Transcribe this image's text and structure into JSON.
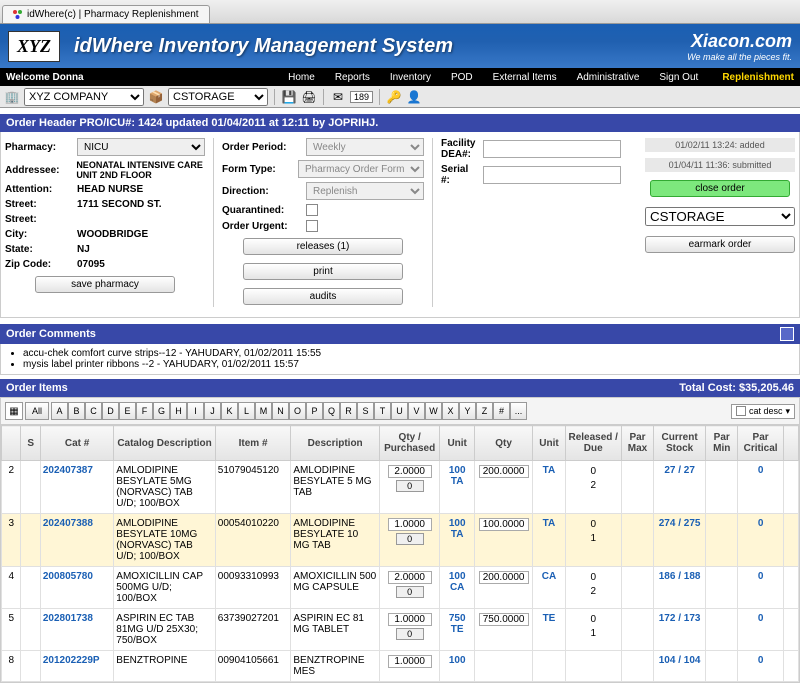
{
  "browser_tab": {
    "title": "idWhere(c) | Pharmacy Replenishment"
  },
  "banner": {
    "logo_text": "XYZ",
    "title": "idWhere Inventory Management System",
    "brand": "Xiacon.com",
    "brand_tag": "We make all the pieces fit."
  },
  "nav": {
    "welcome": "Welcome Donna",
    "items": [
      "Home",
      "Reports",
      "Inventory",
      "POD",
      "External Items",
      "Administrative",
      "Sign Out"
    ],
    "right": "Replenishment"
  },
  "toolbar": {
    "company": "XYZ COMPANY",
    "storage": "CSTORAGE",
    "mail_badge": "189"
  },
  "order_header": {
    "title": "Order Header PRO/ICU#: 1424  updated 01/04/2011 at 12:11 by JOPRIHJ.",
    "pharmacy_label": "Pharmacy:",
    "pharmacy": "NICU",
    "addressee_label": "Addressee:",
    "addressee": "NEONATAL INTENSIVE CARE UNIT 2ND FLOOR",
    "attention_label": "Attention:",
    "attention": "HEAD NURSE",
    "street1_label": "Street:",
    "street1": "1711 SECOND ST.",
    "street2_label": "Street:",
    "street2": "",
    "city_label": "City:",
    "city": "WOODBRIDGE",
    "state_label": "State:",
    "state": "NJ",
    "zip_label": "Zip Code:",
    "zip": "07095",
    "save_pharmacy": "save pharmacy",
    "period_label": "Order Period:",
    "period": "Weekly",
    "formtype_label": "Form Type:",
    "formtype": "Pharmacy Order Form",
    "direction_label": "Direction:",
    "direction": "Replenish",
    "quarantined_label": "Quarantined:",
    "urgent_label": "Order Urgent:",
    "btn_releases": "releases (1)",
    "btn_print": "print",
    "btn_audits": "audits",
    "dea_label": "Facility DEA#:",
    "serial_label": "Serial #:",
    "status1": "01/02/11 13:24: added",
    "status2": "01/04/11 11:36: submitted",
    "close_order": "close order",
    "storage_sel": "CSTORAGE",
    "earmark": "earmark order"
  },
  "comments": {
    "title": "Order Comments",
    "items": [
      "accu-chek comfort curve strips--12 - YAHUDARY, 01/02/2011 15:55",
      "mysis label printer ribbons --2 - YAHUDARY, 01/02/2011 15:57"
    ]
  },
  "order_items": {
    "title": "Order Items",
    "total_label": "Total Cost: $35,205.46",
    "filter_all": "All",
    "letters": [
      "A",
      "B",
      "C",
      "D",
      "E",
      "F",
      "G",
      "H",
      "I",
      "J",
      "K",
      "L",
      "M",
      "N",
      "O",
      "P",
      "Q",
      "R",
      "S",
      "T",
      "U",
      "V",
      "W",
      "X",
      "Y",
      "Z",
      "#",
      "..."
    ],
    "catdesc_label": "cat desc",
    "cols": [
      "",
      "S",
      "Cat #",
      "Catalog Description",
      "Item #",
      "Description",
      "Qty / Purchased",
      "Unit",
      "Qty",
      "Unit",
      "Released / Due",
      "Par Max",
      "Current Stock",
      "Par Min",
      "Par Critical",
      ""
    ],
    "rows": [
      {
        "n": "2",
        "cat": "202407387",
        "catdesc": "AMLODIPINE BESYLATE 5MG (NORVASC) TAB U/D; 100/BOX",
        "item": "51079045120",
        "desc": "AMLODIPINE BESYLATE 5 MG TAB",
        "qtyp": "2.0000",
        "sub": "0",
        "unit1": "100 TA",
        "qty": "200.0000",
        "unit2": "TA",
        "rel": "0",
        "due": "2",
        "stock": "27 / 27",
        "crit": "0",
        "hl": false
      },
      {
        "n": "3",
        "cat": "202407388",
        "catdesc": "AMLODIPINE BESYLATE 10MG (NORVASC) TAB U/D; 100/BOX",
        "item": "00054010220",
        "desc": "AMLODIPINE BESYLATE 10 MG TAB",
        "qtyp": "1.0000",
        "sub": "0",
        "unit1": "100 TA",
        "qty": "100.0000",
        "unit2": "TA",
        "rel": "0",
        "due": "1",
        "stock": "274 / 275",
        "crit": "0",
        "hl": true
      },
      {
        "n": "4",
        "cat": "200805780",
        "catdesc": "AMOXICILLIN CAP 500MG U/D; 100/BOX",
        "item": "00093310993",
        "desc": "AMOXICILLIN 500 MG CAPSULE",
        "qtyp": "2.0000",
        "sub": "0",
        "unit1": "100 CA",
        "qty": "200.0000",
        "unit2": "CA",
        "rel": "0",
        "due": "2",
        "stock": "186 / 188",
        "crit": "0",
        "hl": false
      },
      {
        "n": "5",
        "cat": "202801738",
        "catdesc": "ASPIRIN EC TAB 81MG U/D 25X30; 750/BOX",
        "item": "63739027201",
        "desc": "ASPIRIN EC 81 MG TABLET",
        "qtyp": "1.0000",
        "sub": "0",
        "unit1": "750 TE",
        "qty": "750.0000",
        "unit2": "TE",
        "rel": "0",
        "due": "1",
        "stock": "172 / 173",
        "crit": "0",
        "hl": false
      },
      {
        "n": "8",
        "cat": "201202229P",
        "catdesc": "BENZTROPINE",
        "item": "00904105661",
        "desc": "BENZTROPINE MES",
        "qtyp": "1.0000",
        "sub": "",
        "unit1": "100",
        "qty": "",
        "unit2": "",
        "rel": "",
        "due": "",
        "stock": "104 / 104",
        "crit": "0",
        "hl": false
      }
    ]
  }
}
